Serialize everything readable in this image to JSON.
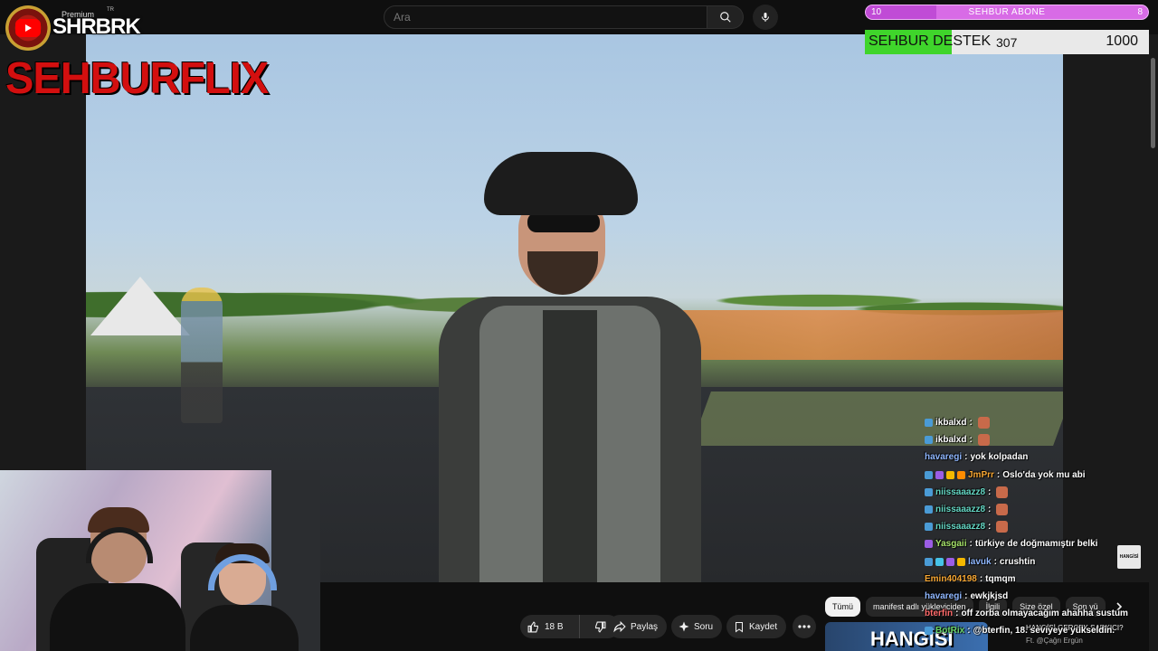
{
  "search": {
    "placeholder": "Ara"
  },
  "branding": {
    "premium_label": "Premium",
    "region": "TR",
    "channel_logo_text": "SHRBRK",
    "overlay_title": "SEHBURFLIX"
  },
  "goals": {
    "abone": {
      "left_value": "10",
      "title": "SEHBUR ABONE",
      "right_value": "8",
      "progress": 0.25,
      "color": "#d86be6"
    },
    "destek": {
      "title": "SEHBUR DESTEK",
      "current": "307",
      "goal": "1000",
      "progress": 0.307,
      "color": "#3fd52b"
    }
  },
  "actions": {
    "like_count": "18 B",
    "share_label": "Paylaş",
    "ask_label": "Soru",
    "save_label": "Kaydet"
  },
  "chips": [
    "Tümü",
    "manifest adlı yükleyiciden",
    "İlgili",
    "Size özel",
    "Son yü"
  ],
  "recommended": {
    "thumb_text": "HANGİSİ",
    "title": "HANGİSİ GERÇEK SARKICI?",
    "subtitle": "Ft. @Çağrı Ergün"
  },
  "chat": [
    {
      "user": "ikbalxd",
      "text": "",
      "color": "#ffffff",
      "badges": [
        "#4a9bd6"
      ],
      "emote": true
    },
    {
      "user": "ikbalxd",
      "text": "",
      "color": "#ffffff",
      "badges": [
        "#4a9bd6"
      ],
      "emote": true
    },
    {
      "user": "havaregi",
      "text": "yok kolpadan",
      "color": "#8fb7ff",
      "badges": [],
      "emote": false
    },
    {
      "user": "JmPrr",
      "text": "Oslo'da yok mu abi",
      "color": "#f7a733",
      "badges": [
        "#4a9bd6",
        "#9b5de5",
        "#f5b800",
        "#ff8c00"
      ],
      "emote": false
    },
    {
      "user": "niissaaazz8",
      "text": "",
      "color": "#64d7c4",
      "badges": [
        "#4a9bd6"
      ],
      "emote": true
    },
    {
      "user": "niissaaazz8",
      "text": "",
      "color": "#64d7c4",
      "badges": [
        "#4a9bd6"
      ],
      "emote": true
    },
    {
      "user": "niissaaazz8",
      "text": "",
      "color": "#64d7c4",
      "badges": [
        "#4a9bd6"
      ],
      "emote": true
    },
    {
      "user": "Yasgaii",
      "text": "türkiye de doğmamıştır belki",
      "color": "#a6e36a",
      "badges": [
        "#9b5de5"
      ],
      "emote": false
    },
    {
      "user": "lavuk",
      "text": "crushtin",
      "color": "#8fb7ff",
      "badges": [
        "#4a9bd6",
        "#46c3e8",
        "#9b5de5",
        "#f5b800"
      ],
      "emote": false
    },
    {
      "user": "Emin404198",
      "text": "tqmqm",
      "color": "#f7a733",
      "badges": [],
      "emote": false
    },
    {
      "user": "havaregi",
      "text": "ewkjkjsd",
      "color": "#8fb7ff",
      "badges": [],
      "emote": false
    },
    {
      "user": "bterfin",
      "text": "off zorba olmayacağım ahahha sustum",
      "color": "#ff6b6b",
      "badges": [],
      "emote": false
    },
    {
      "user": "BotRix",
      "text": "@bterfin, 18. seviyeye yükseldin.",
      "color": "#6bd66b",
      "badges": [
        "#4a9bd6"
      ],
      "emote": false
    }
  ],
  "watermark": "HANGİSİ"
}
